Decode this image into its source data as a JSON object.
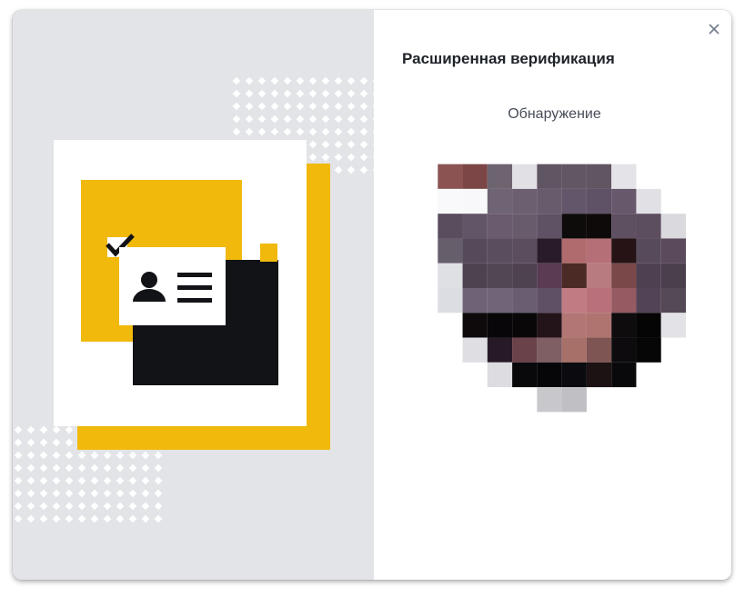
{
  "modal": {
    "title": "Расширенная верификация",
    "status_text": "Обнаружение",
    "close_icon": "close-icon"
  },
  "illustration": {
    "icons": [
      "id-card-icon",
      "user-icon",
      "checkmark-icon"
    ],
    "colors": {
      "accent": "#f0b90b",
      "dark": "#121316",
      "panel": "#e3e4e7"
    }
  },
  "face_preview": {
    "icon": "face-pixelated-image",
    "grid": [
      [
        "",
        "#8b5453",
        "#7c4646",
        "#6d6470",
        "#e1e1e5",
        "#5f5563",
        "#625663",
        "#625562",
        "#e4e4e8",
        "",
        ""
      ],
      [
        "",
        "#f9f9fb",
        "#f8f8fa",
        "#6f6474",
        "#6c5f70",
        "#685b6c",
        "#64566a",
        "#5f5266",
        "#67586c",
        "#e1e1e5",
        ""
      ],
      [
        "",
        "#5a4d5e",
        "#625567",
        "#6a5c6e",
        "#685b6c",
        "#5f5265",
        "#0e0b0b",
        "#0e0a0a",
        "#5e4f61",
        "#5c4d5f",
        "#d9d9de"
      ],
      [
        "",
        "#675e6c",
        "#564a5a",
        "#5a4d5e",
        "#5b4d5e",
        "#2a1b29",
        "#b06b6f",
        "#b56f76",
        "#251315",
        "#574a5a",
        "#5a4a5c"
      ],
      [
        "",
        "#dfe0e4",
        "#4e4150",
        "#524554",
        "#4f4250",
        "#5a3b53",
        "#4b2a25",
        "#b87b80",
        "#7a4848",
        "#4e4050",
        "#4b3e4d"
      ],
      [
        "",
        "#dcdde2",
        "#6f6276",
        "#6f6478",
        "#6a5d71",
        "#5f5065",
        "#c17b83",
        "#b9707a",
        "#965a63",
        "#524456",
        "#554857"
      ],
      [
        "",
        "",
        "#0e0a0c",
        "#080608",
        "#0a0708",
        "#231419",
        "#b27675",
        "#b07470",
        "#0f0c0d",
        "#060505",
        "#e3e3e7"
      ],
      [
        "",
        "",
        "#dedee3",
        "#271a26",
        "#6a4249",
        "#7f5e64",
        "#a77169",
        "#7e5552",
        "#0d0b0d",
        "#070607",
        ""
      ],
      [
        "",
        "",
        "",
        "#dcdce1",
        "#09080a",
        "#060507",
        "#0b0a0e",
        "#1c1113",
        "#09080a",
        "",
        ""
      ],
      [
        "",
        "",
        "",
        "",
        "",
        "#c8c8cc",
        "#bfbfc4",
        "",
        "",
        "",
        ""
      ]
    ]
  }
}
